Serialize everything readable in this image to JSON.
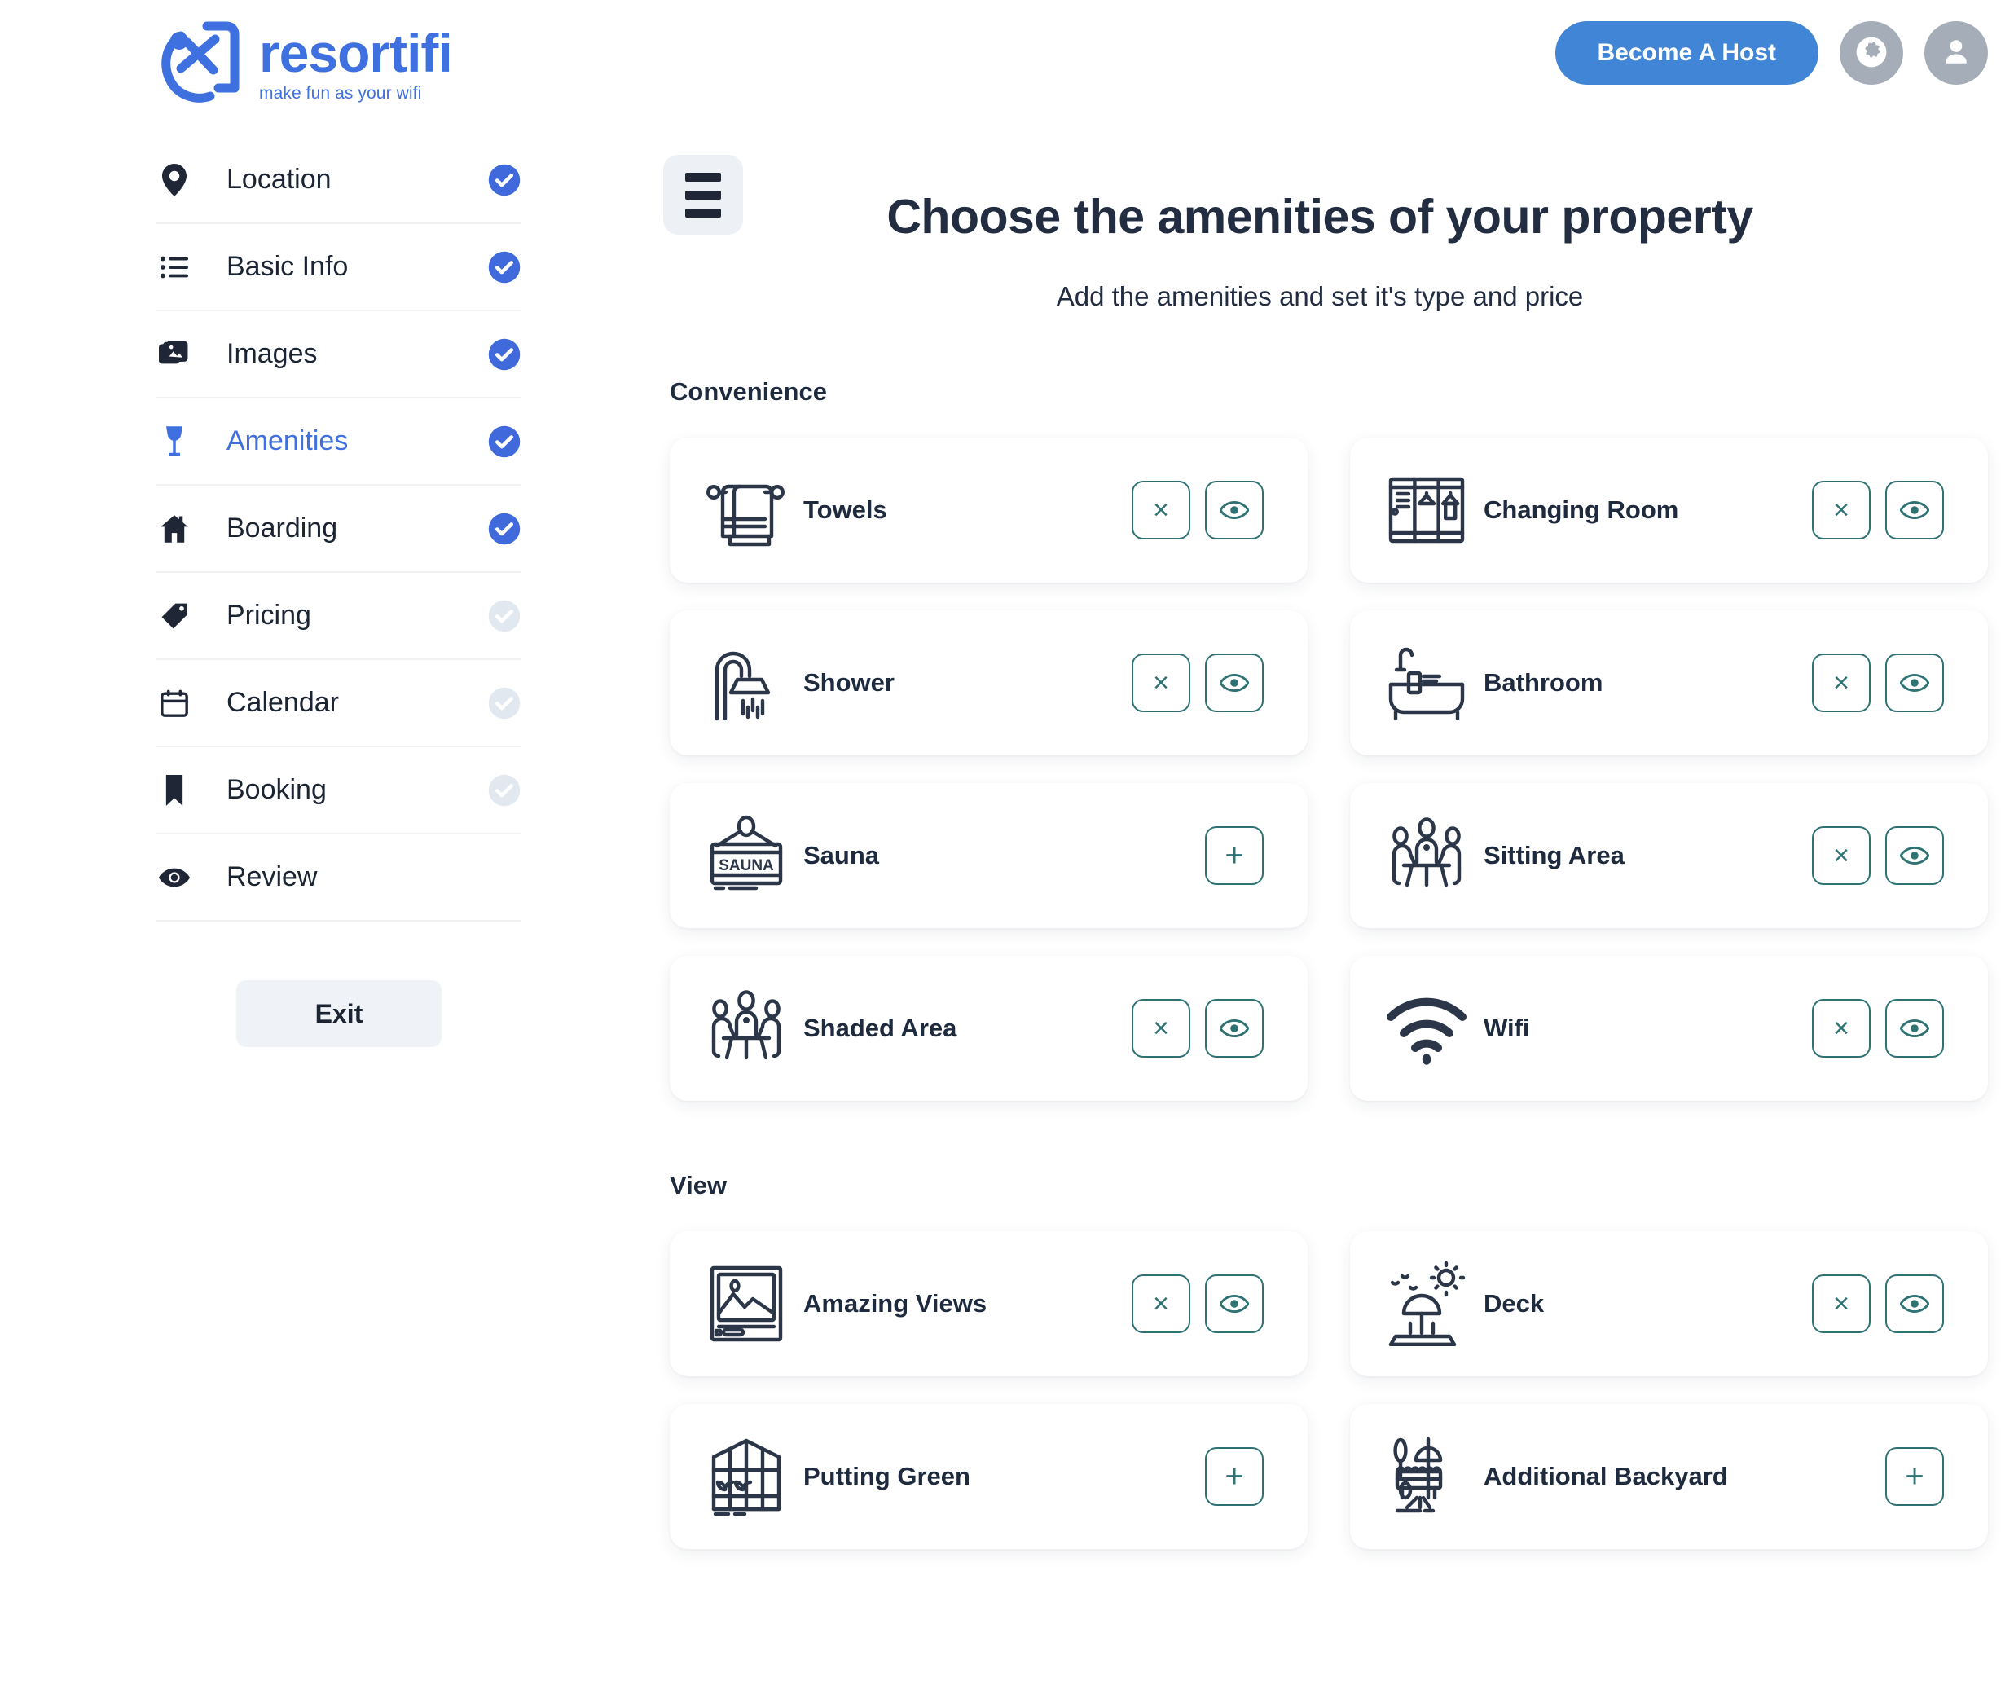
{
  "brand": {
    "name": "resortifi",
    "tagline": "make fun as your wifi",
    "logo_icon": "resortifi-logo-icon"
  },
  "header": {
    "become_host_label": "Become A Host",
    "globe_icon": "globe-icon",
    "account_icon": "user-avatar-icon",
    "accent_color": "#4085d6",
    "circle_color": "#a5adb8"
  },
  "sidebar": {
    "items": [
      {
        "label": "Location",
        "icon": "map-pin-icon",
        "active": false,
        "completed": true,
        "badge": "check-circle-icon"
      },
      {
        "label": "Basic Info",
        "icon": "list-icon",
        "active": false,
        "completed": true,
        "badge": "check-circle-icon"
      },
      {
        "label": "Images",
        "icon": "images-icon",
        "active": false,
        "completed": true,
        "badge": "check-circle-icon"
      },
      {
        "label": "Amenities",
        "icon": "wine-glass-icon",
        "active": true,
        "completed": true,
        "badge": "check-circle-icon"
      },
      {
        "label": "Boarding",
        "icon": "home-icon",
        "active": false,
        "completed": true,
        "badge": "check-circle-icon"
      },
      {
        "label": "Pricing",
        "icon": "price-tag-icon",
        "active": false,
        "completed": false,
        "badge": "check-circle-icon"
      },
      {
        "label": "Calendar",
        "icon": "calendar-icon",
        "active": false,
        "completed": false,
        "badge": "check-circle-icon"
      },
      {
        "label": "Booking",
        "icon": "bookmark-icon",
        "active": false,
        "completed": false,
        "badge": "check-circle-icon"
      },
      {
        "label": "Review",
        "icon": "eye-icon",
        "active": false,
        "completed": false,
        "badge": null
      }
    ],
    "exit_label": "Exit",
    "active_color": "#3e70e0",
    "check_color": "#4069db",
    "check_muted_color": "#dde3ec"
  },
  "main": {
    "menu_icon": "hamburger-menu-icon",
    "title": "Choose the amenities of your property",
    "subtitle": "Add the amenities and set it's type and price",
    "action_color": "#2f7274",
    "sections": [
      {
        "title": "Convenience",
        "amenities": [
          {
            "label": "Towels",
            "icon": "towel-icon",
            "actions": [
              "remove",
              "view"
            ]
          },
          {
            "label": "Changing Room",
            "icon": "lockers-icon",
            "actions": [
              "remove",
              "view"
            ]
          },
          {
            "label": "Shower",
            "icon": "shower-icon",
            "actions": [
              "remove",
              "view"
            ]
          },
          {
            "label": "Bathroom",
            "icon": "bathtub-icon",
            "actions": [
              "remove",
              "view"
            ]
          },
          {
            "label": "Sauna",
            "icon": "sauna-sign-icon",
            "actions": [
              "add"
            ]
          },
          {
            "label": "Sitting Area",
            "icon": "sitting-area-icon",
            "actions": [
              "remove",
              "view"
            ]
          },
          {
            "label": "Shaded Area",
            "icon": "shaded-area-icon",
            "actions": [
              "remove",
              "view"
            ]
          },
          {
            "label": "Wifi",
            "icon": "wifi-icon",
            "actions": [
              "remove",
              "view"
            ]
          }
        ]
      },
      {
        "title": "View",
        "amenities": [
          {
            "label": "Amazing Views",
            "icon": "framed-picture-icon",
            "actions": [
              "remove",
              "view"
            ]
          },
          {
            "label": "Deck",
            "icon": "beach-umbrella-icon",
            "actions": [
              "remove",
              "view"
            ]
          },
          {
            "label": "Putting Green",
            "icon": "greenhouse-icon",
            "actions": [
              "add"
            ]
          },
          {
            "label": "Additional Backyard",
            "icon": "backyard-grill-icon",
            "actions": [
              "add"
            ]
          }
        ]
      }
    ],
    "action_labels": {
      "remove": "×",
      "view": "eye-icon",
      "add": "+"
    }
  }
}
